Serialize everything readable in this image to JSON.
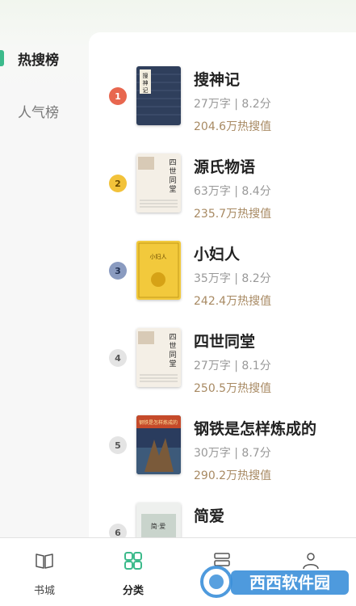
{
  "sidebar": {
    "items": [
      {
        "label": "热搜榜"
      },
      {
        "label": "人气榜"
      }
    ]
  },
  "books": [
    {
      "rank": "1",
      "title": "搜神记",
      "meta": "27万字 | 8.2分",
      "hot": "204.6万热搜值",
      "cover_text": "搜神记"
    },
    {
      "rank": "2",
      "title": "源氏物语",
      "meta": "63万字 | 8.4分",
      "hot": "235.7万热搜值",
      "cover_text": "四世同堂"
    },
    {
      "rank": "3",
      "title": "小妇人",
      "meta": "35万字 | 8.2分",
      "hot": "242.4万热搜值",
      "cover_text": "小妇人"
    },
    {
      "rank": "4",
      "title": "四世同堂",
      "meta": "27万字 | 8.1分",
      "hot": "250.5万热搜值",
      "cover_text": "四世同堂"
    },
    {
      "rank": "5",
      "title": "钢铁是怎样炼成的",
      "meta": "30万字 | 8.7分",
      "hot": "290.2万热搜值",
      "cover_text": "钢铁是怎样炼成的"
    },
    {
      "rank": "6",
      "title": "简爱",
      "meta": "",
      "hot": "",
      "cover_text": "简爱"
    }
  ],
  "tabbar": {
    "items": [
      {
        "label": "书城",
        "icon": "book-open-icon"
      },
      {
        "label": "分类",
        "icon": "grid-icon"
      },
      {
        "label": "",
        "icon": "shelf-icon"
      },
      {
        "label": "",
        "icon": "user-icon"
      }
    ]
  },
  "watermark": {
    "text": "西西软件园"
  },
  "colors": {
    "accent": "#3cba8b",
    "hot": "#a88a63",
    "rank1": "#e8674f",
    "rank2": "#f2c23a",
    "rank3": "#8a9bc0",
    "rankOther": "#d8d8d8"
  }
}
